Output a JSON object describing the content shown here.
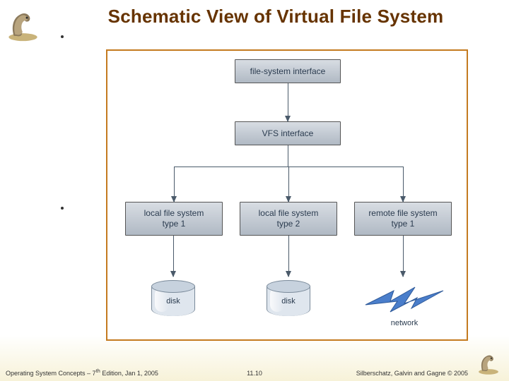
{
  "title": "Schematic View of Virtual File System",
  "boxes": {
    "fsi": "file-system interface",
    "vfs": "VFS interface",
    "l1": "local file system\ntype 1",
    "l2": "local file system\ntype 2",
    "l3": "remote file system\ntype 1"
  },
  "storage": {
    "disk1": "disk",
    "disk2": "disk",
    "network": "network"
  },
  "footer": {
    "left_prefix": "Operating System Concepts – 7",
    "left_sup": "th",
    "left_suffix": " Edition, Jan 1, 2005",
    "center": "11.10",
    "right": "Silberschatz, Galvin and Gagne © 2005"
  },
  "colors": {
    "title": "#663300",
    "frame_border": "#c47a1f",
    "box_text": "#2a3b4f"
  }
}
